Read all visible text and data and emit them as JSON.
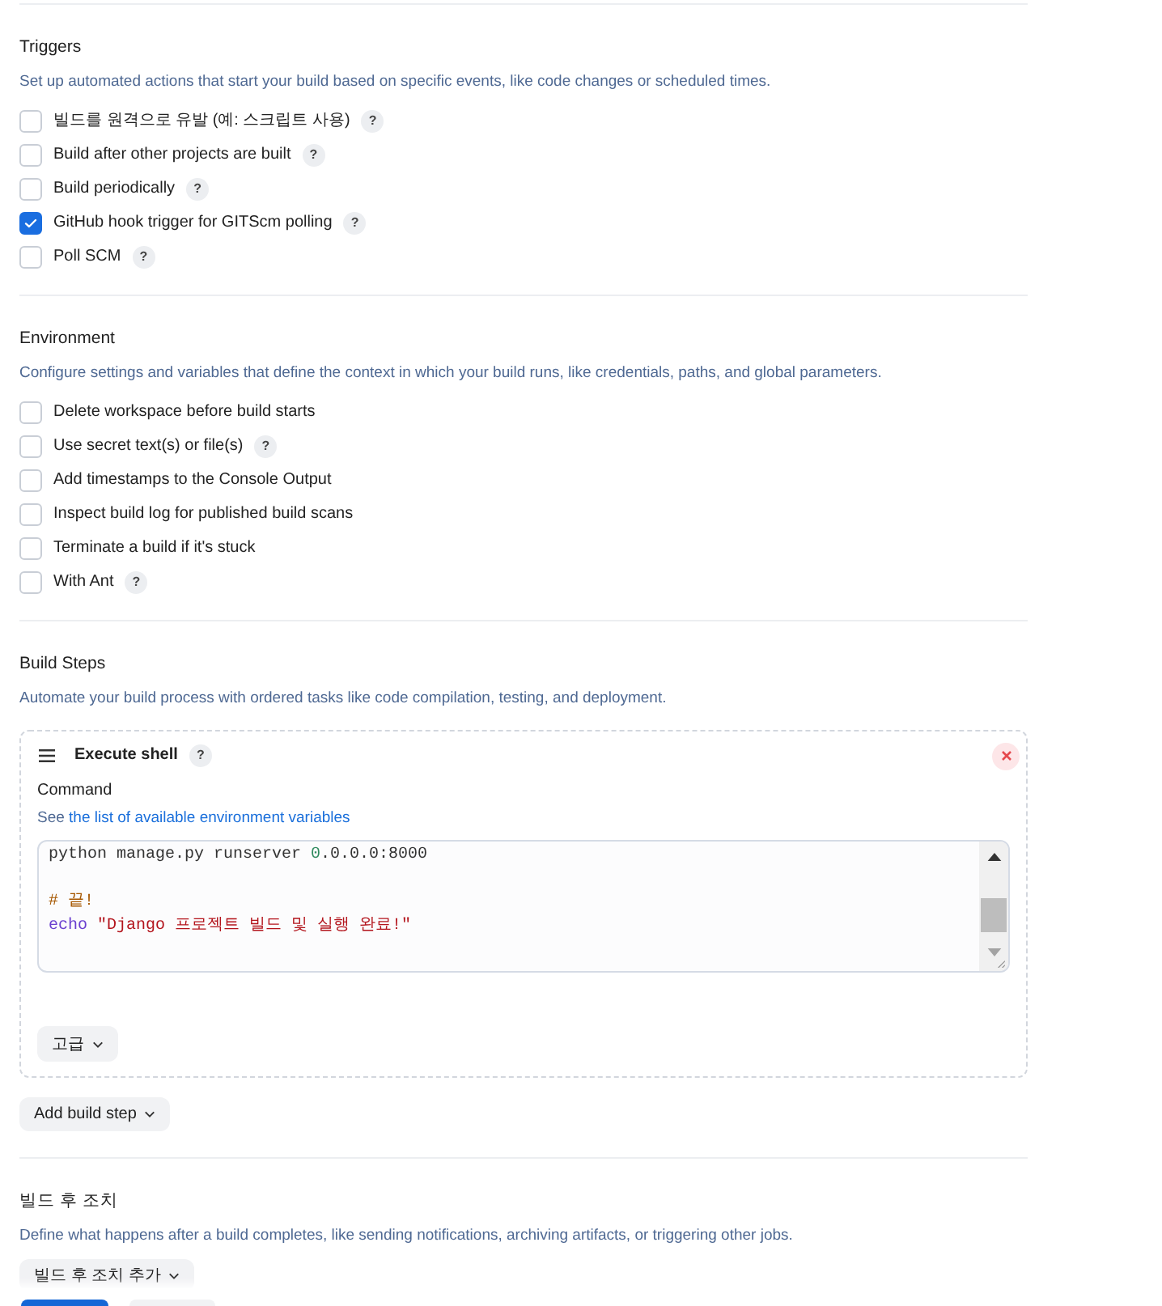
{
  "sections": [
    {
      "kind": "checklist",
      "title": "Triggers",
      "description": "Set up automated actions that start your build based on specific events, like code changes or scheduled times.",
      "options": [
        {
          "label": "빌드를 원격으로 유발 (예: 스크립트 사용)",
          "help": "?",
          "checked": false
        },
        {
          "label": "Build after other projects are built",
          "help": "?",
          "checked": false
        },
        {
          "label": "Build periodically",
          "help": "?",
          "checked": false
        },
        {
          "label": "GitHub hook trigger for GITScm polling",
          "help": "?",
          "checked": true
        },
        {
          "label": "Poll SCM",
          "help": "?",
          "checked": false
        }
      ]
    },
    {
      "kind": "checklist",
      "title": "Environment",
      "description": "Configure settings and variables that define the context in which your build runs, like credentials, paths, and global parameters.",
      "options": [
        {
          "label": "Delete workspace before build starts",
          "checked": false
        },
        {
          "label": "Use secret text(s) or file(s)",
          "help": "?",
          "checked": false
        },
        {
          "label": "Add timestamps to the Console Output",
          "checked": false
        },
        {
          "label": "Inspect build log for published build scans",
          "checked": false
        },
        {
          "label": "Terminate a build if it's stuck",
          "checked": false
        },
        {
          "label": "With Ant",
          "help": "?",
          "checked": false
        }
      ]
    },
    {
      "kind": "steps",
      "title": "Build Steps",
      "description": "Automate your build process with ordered tasks like code compilation, testing, and deployment.",
      "steps": [
        {
          "title": "Execute shell",
          "help": "?",
          "field_label": "Command",
          "hint": {
            "prefix": "See",
            "link": "the list of available environment variables"
          },
          "code": [
            {
              "kind": "code",
              "tokens": [
                {
                  "kind": "plain",
                  "text": "python manage.py runserver "
                },
                {
                  "kind": "number",
                  "text": "0"
                },
                {
                  "kind": "plain",
                  "text": ".0.0.0:8000"
                }
              ]
            },
            {
              "kind": "blank"
            },
            {
              "kind": "code",
              "tokens": [
                {
                  "kind": "comment",
                  "text": "# 끝!"
                }
              ]
            },
            {
              "kind": "code",
              "tokens": [
                {
                  "kind": "keyword",
                  "text": "echo"
                },
                {
                  "kind": "string",
                  "text": "\"Django 프로젝트 빌드 및 실행 완료!\""
                }
              ]
            }
          ],
          "advanced_button": "고급"
        }
      ],
      "add_button": "Add build step"
    },
    {
      "kind": "actions",
      "title": "빌드 후 조치",
      "description": "Define what happens after a build completes, like sending notifications, archiving artifacts, or triggering other jobs.",
      "add_button": "빌드 후 조치 추가"
    }
  ],
  "footer": {
    "buttons": [
      {
        "kind": "primary"
      },
      {
        "kind": "secondary"
      }
    ]
  }
}
